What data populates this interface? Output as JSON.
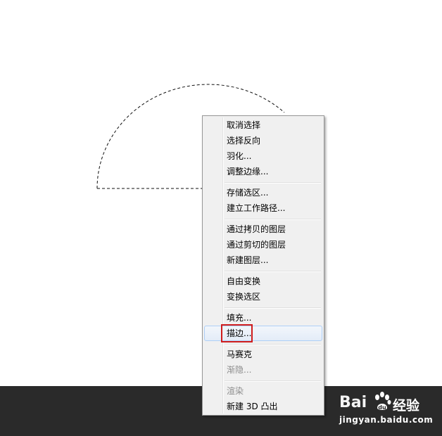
{
  "context_menu": {
    "items": [
      {
        "label": "取消选择",
        "enabled": true
      },
      {
        "label": "选择反向",
        "enabled": true
      },
      {
        "label": "羽化...",
        "enabled": true
      },
      {
        "label": "调整边缘...",
        "enabled": true
      },
      {
        "label": "存储选区...",
        "enabled": true
      },
      {
        "label": "建立工作路径...",
        "enabled": true
      },
      {
        "label": "通过拷贝的图层",
        "enabled": true
      },
      {
        "label": "通过剪切的图层",
        "enabled": true
      },
      {
        "label": "新建图层...",
        "enabled": true
      },
      {
        "label": "自由变换",
        "enabled": true
      },
      {
        "label": "变换选区",
        "enabled": true
      },
      {
        "label": "填充...",
        "enabled": true
      },
      {
        "label": "描边...",
        "enabled": true,
        "hovered": true,
        "highlighted": true
      },
      {
        "label": "马赛克",
        "enabled": true
      },
      {
        "label": "渐隐...",
        "enabled": false
      },
      {
        "label": "渲染",
        "enabled": false
      },
      {
        "label": "新建 3D 凸出",
        "enabled": true
      }
    ]
  },
  "watermark": {
    "brand_left": "Bai",
    "brand_right": "经验",
    "url": "jingyan.baidu.com"
  },
  "colors": {
    "highlight_box": "#d01c1c",
    "bottom_bar": "#2a2a2a",
    "menu_bg": "#f0f0f0"
  }
}
